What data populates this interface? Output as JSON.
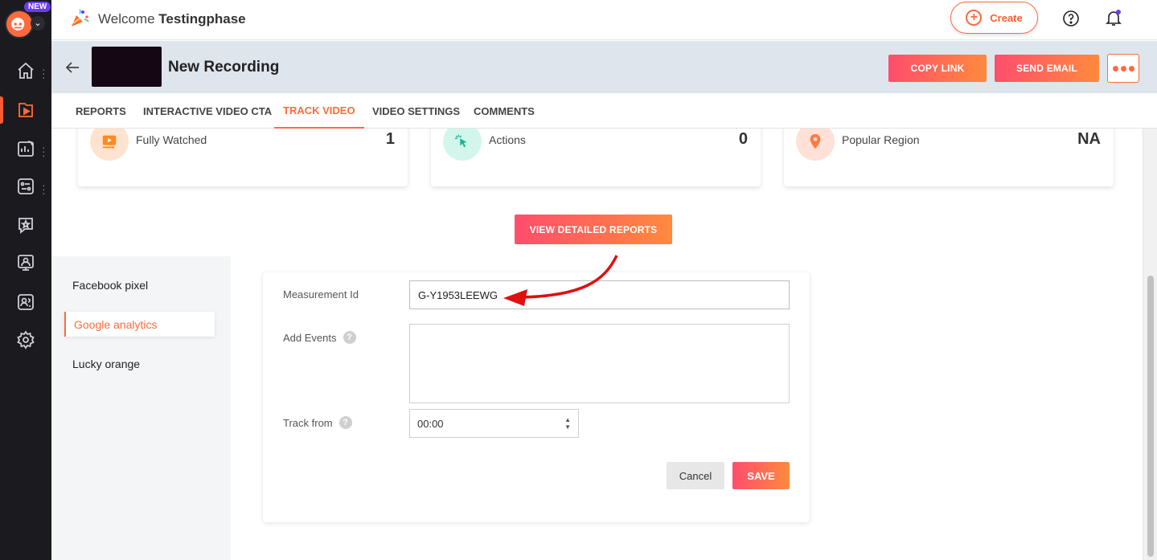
{
  "app": {
    "new_badge": "NEW",
    "welcome_prefix": "Welcome",
    "welcome_name": "Testingphase",
    "create_label": "Create",
    "brand_color": "#ff6a3d"
  },
  "recording": {
    "title": "New Recording",
    "copy_link": "COPY LINK",
    "send_email": "SEND EMAIL"
  },
  "tabs": [
    {
      "label": "REPORTS"
    },
    {
      "label": "INTERACTIVE VIDEO CTA"
    },
    {
      "label": "TRACK VIDEO",
      "active": true
    },
    {
      "label": "VIDEO SETTINGS"
    },
    {
      "label": "COMMENTS"
    }
  ],
  "stats": [
    {
      "label": "Fully Watched",
      "value": "1",
      "icon": "video-play-icon"
    },
    {
      "label": "Actions",
      "value": "0",
      "icon": "cursor-click-icon"
    },
    {
      "label": "Popular Region",
      "value": "NA",
      "icon": "location-pin-icon"
    }
  ],
  "detailed_reports": "VIEW DETAILED REPORTS",
  "integrations": [
    {
      "label": "Facebook pixel"
    },
    {
      "label": "Google analytics",
      "active": true
    },
    {
      "label": "Lucky orange"
    }
  ],
  "form": {
    "measurement_label": "Measurement Id",
    "measurement_value": "G-Y1953LEEWG",
    "events_label": "Add Events",
    "track_from_label": "Track from",
    "track_from_value": "00:00",
    "help_glyph": "?",
    "cancel": "Cancel",
    "save": "SAVE"
  },
  "sidebar_icons": [
    "home-icon",
    "video-icon",
    "analytics-icon",
    "settings-panel-icon",
    "feedback-icon",
    "presenter-icon",
    "contacts-icon",
    "gear-icon"
  ]
}
